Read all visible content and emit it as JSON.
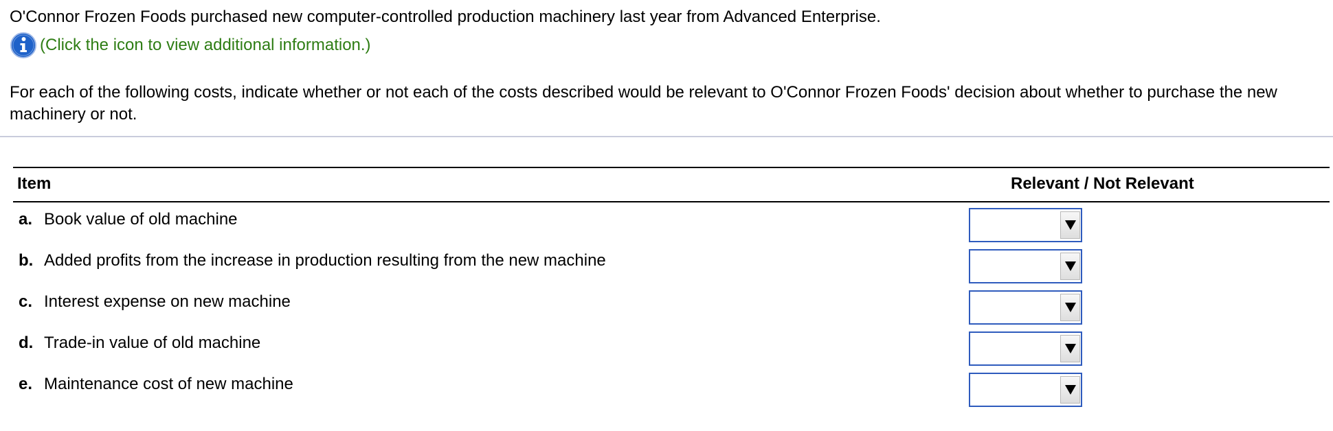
{
  "intro_text": "O'Connor Frozen Foods purchased new computer-controlled production machinery last year from Advanced Enterprise.",
  "info": {
    "icon": "info-icon",
    "link_text": "(Click the icon to view additional information.)",
    "link_color": "#2e7d14"
  },
  "instructions": "For each of the following costs, indicate whether or not each of the costs described would be relevant to O'Connor Frozen Foods' decision about whether to purchase the new machinery or not.",
  "table": {
    "headers": {
      "item": "Item",
      "relevance": "Relevant / Not Relevant"
    },
    "rows": [
      {
        "letter": "a.",
        "text": "Book value of old machine",
        "selected": ""
      },
      {
        "letter": "b.",
        "text": "Added profits from the increase in production resulting from the new machine",
        "selected": ""
      },
      {
        "letter": "c.",
        "text": "Interest expense on new machine",
        "selected": ""
      },
      {
        "letter": "d.",
        "text": "Trade-in value of old machine",
        "selected": ""
      },
      {
        "letter": "e.",
        "text": "Maintenance cost of new machine",
        "selected": ""
      }
    ]
  },
  "colors": {
    "dropdown_border": "#2e5bbd",
    "info_icon": "#1f62c9",
    "divider": "#c9ccdc"
  }
}
